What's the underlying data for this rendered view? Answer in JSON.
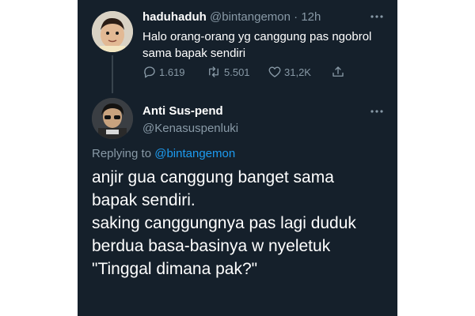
{
  "tweet1": {
    "display_name": "haduhaduh",
    "handle": "@bintangemon",
    "separator": "·",
    "time": "12h",
    "text": "Halo orang-orang yg canggung pas ngobrol sama bapak sendiri",
    "replies": "1.619",
    "retweets": "5.501",
    "likes": "31,2K"
  },
  "tweet2": {
    "display_name": "Anti Sus-pend",
    "handle": "@Kenasuspenluki",
    "replying_prefix": "Replying to",
    "replying_handle": "@bintangemon",
    "text": "anjir gua canggung banget sama\nbapak sendiri.\nsaking canggungnya pas lagi duduk\nberdua basa-basinya w nyeletuk\n\"Tinggal dimana pak?\""
  },
  "colors": {
    "background": "#15202b",
    "text": "#ffffff",
    "muted": "#8899a6",
    "link": "#1d9bf0"
  },
  "icons": [
    "more-icon",
    "reply-icon",
    "retweet-icon",
    "like-icon",
    "share-icon"
  ]
}
